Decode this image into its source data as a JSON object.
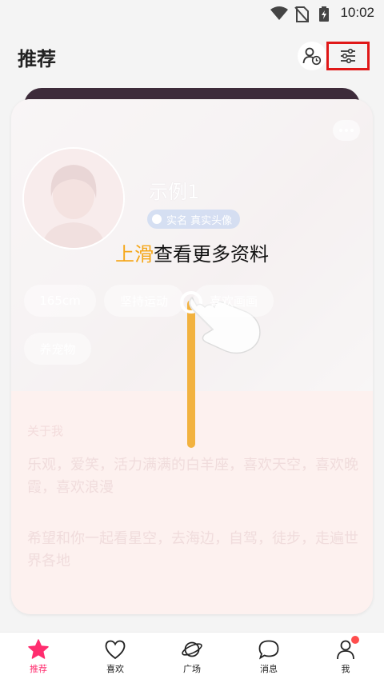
{
  "status": {
    "time": "10:02"
  },
  "header": {
    "title": "推荐"
  },
  "card": {
    "name": "示例1",
    "verify_badge": "实名 真实头像",
    "tags": [
      "165cm",
      "坚持运动",
      "喜欢画画",
      "养宠物"
    ],
    "about_label": "关于我",
    "about_paragraphs": [
      "乐观，爱笑，活力满满的白羊座，喜欢天空，喜欢晚霞，喜欢浪漫",
      "希望和你一起看星空，去海边，自驾，徒步，走遍世界各地"
    ]
  },
  "guide": {
    "highlight": "上滑",
    "rest": "查看更多资料"
  },
  "nav": [
    {
      "label": "推荐",
      "icon": "star-icon",
      "active": true
    },
    {
      "label": "喜欢",
      "icon": "heart-icon"
    },
    {
      "label": "广场",
      "icon": "planet-icon"
    },
    {
      "label": "消息",
      "icon": "chat-bubble-icon"
    },
    {
      "label": "我",
      "icon": "person-icon"
    }
  ],
  "colors": {
    "accent": "#ff2d6f",
    "guide_highlight": "#f5a71a",
    "swipe_line": "#f2b23f",
    "filter_highlight_border": "#e01818"
  }
}
